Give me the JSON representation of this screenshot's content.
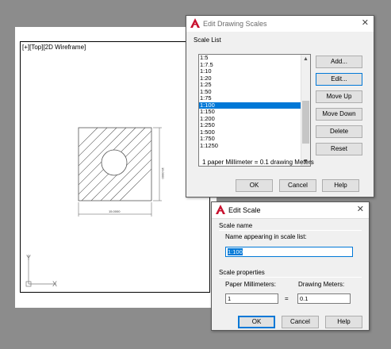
{
  "viewport": {
    "label": "[+][Top][2D Wireframe]"
  },
  "drawing": {
    "dim_horizontal": "15.0000",
    "dim_vertical": "15.0000",
    "ucs_x": "X",
    "ucs_y": "Y"
  },
  "edit_drawing_scales": {
    "title": "Edit Drawing Scales",
    "close": "✕",
    "scale_list_label": "Scale List",
    "items": [
      "1:5",
      "1:7.5",
      "1:10",
      "1:20",
      "1:25",
      "1:50",
      "1:75",
      "1:100",
      "1:150",
      "1:200",
      "1:250",
      "1:500",
      "1:750",
      "1:1250"
    ],
    "selected_index": 7,
    "buttons": {
      "add": "Add...",
      "edit": "Edit...",
      "move_up": "Move Up",
      "move_down": "Move Down",
      "delete": "Delete",
      "reset": "Reset"
    },
    "info": "1 paper Millimeter = 0.1 drawing Meters",
    "ok": "OK",
    "cancel": "Cancel",
    "help": "Help"
  },
  "edit_scale": {
    "title": "Edit Scale",
    "close": "✕",
    "scale_name_label": "Scale name",
    "name_label": "Name appearing in scale list:",
    "name_value": "1:100",
    "scale_properties_label": "Scale properties",
    "paper_label": "Paper Millimeters:",
    "drawing_label": "Drawing Meters:",
    "paper_value": "1",
    "equals": "=",
    "drawing_value": "0.1",
    "ok": "OK",
    "cancel": "Cancel",
    "help": "Help"
  },
  "colors": {
    "selection": "#0078d7",
    "dialog_bg": "#f0f0f0",
    "app_icon": "#c8102e"
  }
}
